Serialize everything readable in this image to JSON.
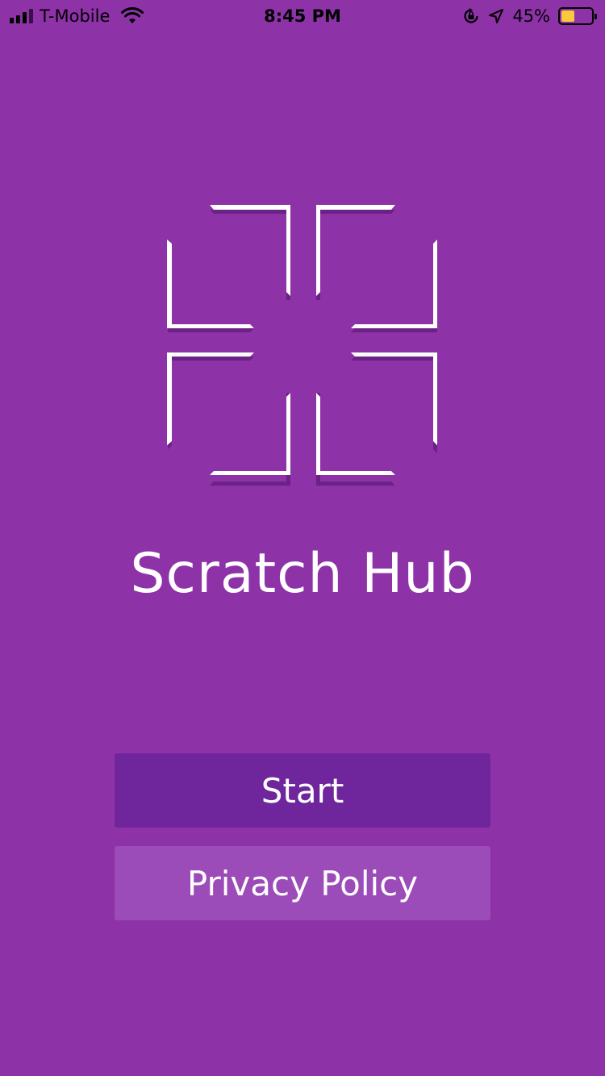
{
  "status_bar": {
    "carrier": "T-Mobile",
    "time": "8:45 PM",
    "battery_percent": "45%",
    "battery_level": 0.45,
    "icons": [
      "signal-icon",
      "wifi-icon",
      "rotation-lock-icon",
      "location-icon",
      "battery-icon"
    ]
  },
  "app": {
    "title": "Scratch Hub",
    "logo_icon": "scratch-hub-logo-icon"
  },
  "buttons": {
    "start_label": "Start",
    "privacy_label": "Privacy Policy"
  },
  "colors": {
    "background": "#8e32a8",
    "start_button": "#6f259b",
    "privacy_button": "#9c4cb8",
    "battery_fill": "#f7c93b",
    "logo_shadow": "#6b2185"
  }
}
